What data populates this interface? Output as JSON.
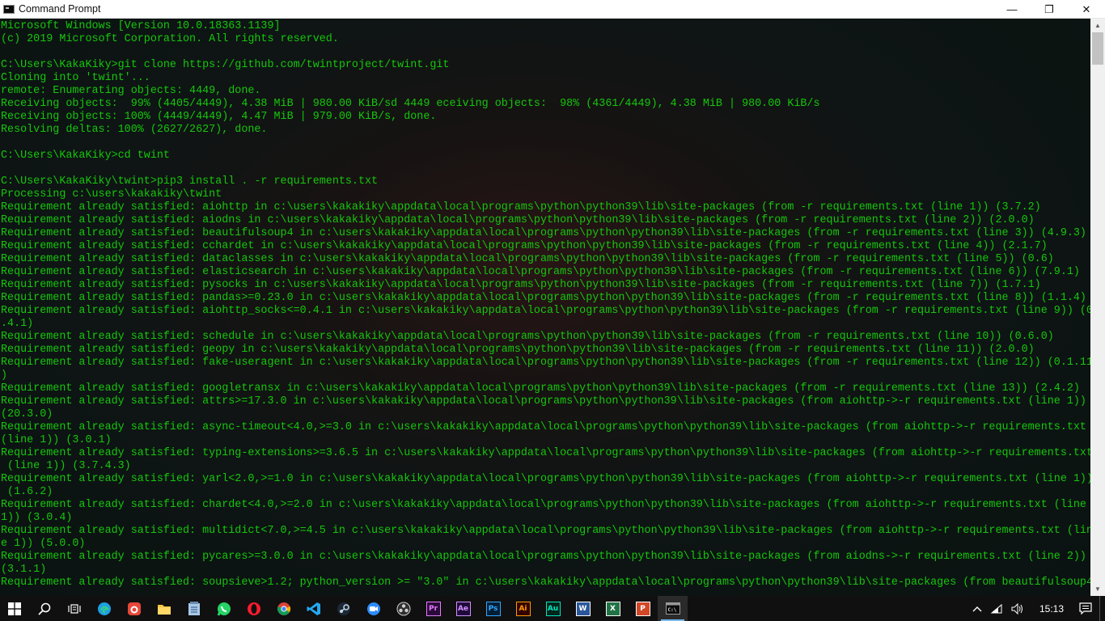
{
  "window": {
    "title": "Command Prompt",
    "min_glyph": "—",
    "max_glyph": "❐",
    "close_glyph": "✕"
  },
  "console": {
    "text_color": "#16c60c",
    "lines": [
      "Microsoft Windows [Version 10.0.18363.1139]",
      "(c) 2019 Microsoft Corporation. All rights reserved.",
      "",
      "C:\\Users\\KakaKiky>git clone https://github.com/twintproject/twint.git",
      "Cloning into 'twint'...",
      "remote: Enumerating objects: 4449, done.",
      "Receiving objects:  99% (4405/4449), 4.38 MiB | 980.00 KiB/sd 4449 eceiving objects:  98% (4361/4449), 4.38 MiB | 980.00 KiB/s",
      "Receiving objects: 100% (4449/4449), 4.47 MiB | 979.00 KiB/s, done.",
      "Resolving deltas: 100% (2627/2627), done.",
      "",
      "C:\\Users\\KakaKiky>cd twint",
      "",
      "C:\\Users\\KakaKiky\\twint>pip3 install . -r requirements.txt",
      "Processing c:\\users\\kakakiky\\twint",
      "Requirement already satisfied: aiohttp in c:\\users\\kakakiky\\appdata\\local\\programs\\python\\python39\\lib\\site-packages (from -r requirements.txt (line 1)) (3.7.2)",
      "Requirement already satisfied: aiodns in c:\\users\\kakakiky\\appdata\\local\\programs\\python\\python39\\lib\\site-packages (from -r requirements.txt (line 2)) (2.0.0)",
      "Requirement already satisfied: beautifulsoup4 in c:\\users\\kakakiky\\appdata\\local\\programs\\python\\python39\\lib\\site-packages (from -r requirements.txt (line 3)) (4.9.3)",
      "Requirement already satisfied: cchardet in c:\\users\\kakakiky\\appdata\\local\\programs\\python\\python39\\lib\\site-packages (from -r requirements.txt (line 4)) (2.1.7)",
      "Requirement already satisfied: dataclasses in c:\\users\\kakakiky\\appdata\\local\\programs\\python\\python39\\lib\\site-packages (from -r requirements.txt (line 5)) (0.6)",
      "Requirement already satisfied: elasticsearch in c:\\users\\kakakiky\\appdata\\local\\programs\\python\\python39\\lib\\site-packages (from -r requirements.txt (line 6)) (7.9.1)",
      "Requirement already satisfied: pysocks in c:\\users\\kakakiky\\appdata\\local\\programs\\python\\python39\\lib\\site-packages (from -r requirements.txt (line 7)) (1.7.1)",
      "Requirement already satisfied: pandas>=0.23.0 in c:\\users\\kakakiky\\appdata\\local\\programs\\python\\python39\\lib\\site-packages (from -r requirements.txt (line 8)) (1.1.4)",
      "Requirement already satisfied: aiohttp_socks<=0.4.1 in c:\\users\\kakakiky\\appdata\\local\\programs\\python\\python39\\lib\\site-packages (from -r requirements.txt (line 9)) (0",
      ".4.1)",
      "Requirement already satisfied: schedule in c:\\users\\kakakiky\\appdata\\local\\programs\\python\\python39\\lib\\site-packages (from -r requirements.txt (line 10)) (0.6.0)",
      "Requirement already satisfied: geopy in c:\\users\\kakakiky\\appdata\\local\\programs\\python\\python39\\lib\\site-packages (from -r requirements.txt (line 11)) (2.0.0)",
      "Requirement already satisfied: fake-useragent in c:\\users\\kakakiky\\appdata\\local\\programs\\python\\python39\\lib\\site-packages (from -r requirements.txt (line 12)) (0.1.11",
      ")",
      "Requirement already satisfied: googletransx in c:\\users\\kakakiky\\appdata\\local\\programs\\python\\python39\\lib\\site-packages (from -r requirements.txt (line 13)) (2.4.2)",
      "Requirement already satisfied: attrs>=17.3.0 in c:\\users\\kakakiky\\appdata\\local\\programs\\python\\python39\\lib\\site-packages (from aiohttp->-r requirements.txt (line 1))",
      "(20.3.0)",
      "Requirement already satisfied: async-timeout<4.0,>=3.0 in c:\\users\\kakakiky\\appdata\\local\\programs\\python\\python39\\lib\\site-packages (from aiohttp->-r requirements.txt",
      "(line 1)) (3.0.1)",
      "Requirement already satisfied: typing-extensions>=3.6.5 in c:\\users\\kakakiky\\appdata\\local\\programs\\python\\python39\\lib\\site-packages (from aiohttp->-r requirements.txt",
      " (line 1)) (3.7.4.3)",
      "Requirement already satisfied: yarl<2.0,>=1.0 in c:\\users\\kakakiky\\appdata\\local\\programs\\python\\python39\\lib\\site-packages (from aiohttp->-r requirements.txt (line 1))",
      " (1.6.2)",
      "Requirement already satisfied: chardet<4.0,>=2.0 in c:\\users\\kakakiky\\appdata\\local\\programs\\python\\python39\\lib\\site-packages (from aiohttp->-r requirements.txt (line",
      "1)) (3.0.4)",
      "Requirement already satisfied: multidict<7.0,>=4.5 in c:\\users\\kakakiky\\appdata\\local\\programs\\python\\python39\\lib\\site-packages (from aiohttp->-r requirements.txt (lin",
      "e 1)) (5.0.0)",
      "Requirement already satisfied: pycares>=3.0.0 in c:\\users\\kakakiky\\appdata\\local\\programs\\python\\python39\\lib\\site-packages (from aiodns->-r requirements.txt (line 2))",
      "(3.1.1)",
      "Requirement already satisfied: soupsieve>1.2; python_version >= \"3.0\" in c:\\users\\kakakiky\\appdata\\local\\programs\\python\\python39\\lib\\site-packages (from beautifulsoup4"
    ]
  },
  "taskbar": {
    "apps": [
      {
        "name": "start-button",
        "icon": "windows-logo-icon"
      },
      {
        "name": "search-button",
        "icon": "search-icon"
      },
      {
        "name": "task-view-button",
        "icon": "task-view-icon"
      },
      {
        "name": "taskbar-edge",
        "icon": "edge-icon",
        "color": "#1fa0e3"
      },
      {
        "name": "taskbar-app-red",
        "icon": "app-red-icon",
        "color": "#e8473a"
      },
      {
        "name": "taskbar-file-explorer",
        "icon": "folder-icon",
        "color": "#f5c542"
      },
      {
        "name": "taskbar-notepad",
        "icon": "notepad-icon",
        "color": "#a8c8e8"
      },
      {
        "name": "taskbar-whatsapp",
        "icon": "whatsapp-icon",
        "color": "#25d366"
      },
      {
        "name": "taskbar-opera",
        "icon": "opera-icon",
        "color": "#ff1b2d"
      },
      {
        "name": "taskbar-chrome",
        "icon": "chrome-icon",
        "color": "#4caf50"
      },
      {
        "name": "taskbar-vscode",
        "icon": "vscode-icon",
        "color": "#23a9f2"
      },
      {
        "name": "taskbar-steam",
        "icon": "steam-icon",
        "color": "#c7d5e0"
      },
      {
        "name": "taskbar-zoom",
        "icon": "zoom-icon",
        "color": "#2d8cff"
      },
      {
        "name": "taskbar-obs",
        "icon": "obs-icon",
        "color": "#cfcfcf"
      },
      {
        "name": "taskbar-premiere",
        "icon": "premiere-icon",
        "label": "Pr",
        "color": "#e77bff",
        "bg": "#2a0a3a"
      },
      {
        "name": "taskbar-after-effects",
        "icon": "after-effects-icon",
        "label": "Ae",
        "color": "#d291ff",
        "bg": "#1f0a3a"
      },
      {
        "name": "taskbar-photoshop",
        "icon": "photoshop-icon",
        "label": "Ps",
        "color": "#31a8ff",
        "bg": "#001e36"
      },
      {
        "name": "taskbar-illustrator",
        "icon": "illustrator-icon",
        "label": "Ai",
        "color": "#ff9a00",
        "bg": "#330000"
      },
      {
        "name": "taskbar-audition",
        "icon": "audition-icon",
        "label": "Au",
        "color": "#00e4bb",
        "bg": "#00261c"
      },
      {
        "name": "taskbar-word",
        "icon": "word-icon",
        "label": "W",
        "color": "#ffffff",
        "bg": "#2b579a"
      },
      {
        "name": "taskbar-excel",
        "icon": "excel-icon",
        "label": "X",
        "color": "#ffffff",
        "bg": "#217346"
      },
      {
        "name": "taskbar-powerpoint",
        "icon": "powerpoint-icon",
        "label": "P",
        "color": "#ffffff",
        "bg": "#d24726"
      },
      {
        "name": "taskbar-command-prompt",
        "icon": "command-prompt-icon",
        "active": true
      }
    ],
    "tray": {
      "chevron": "^",
      "clock": "15:13",
      "notification_glyph": "▤"
    }
  }
}
